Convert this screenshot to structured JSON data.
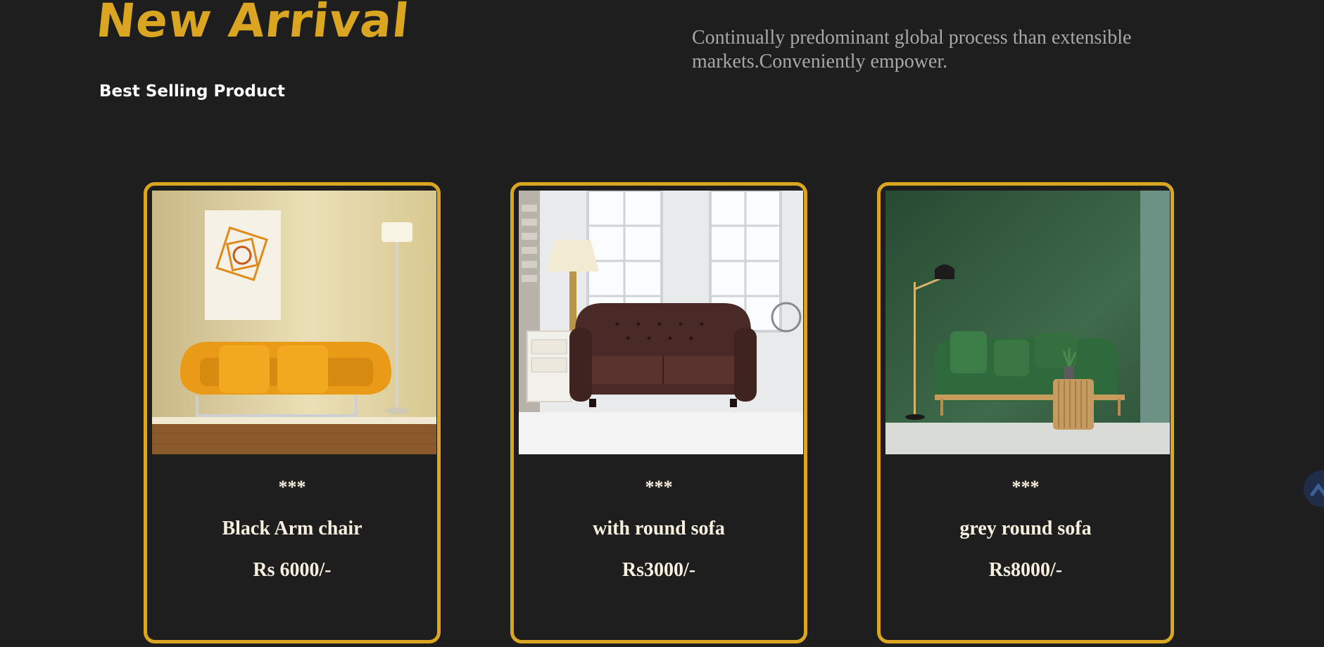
{
  "header": {
    "title": "New Arrival",
    "subtitle": "Best Selling Product",
    "tagline": "Continually predominant global process than extensible markets.Conveniently empower."
  },
  "products": [
    {
      "stars": "***",
      "name": "Black Arm chair",
      "price": "Rs 6000/-",
      "image": "orange-sofa-image"
    },
    {
      "stars": "***",
      "name": "with round sofa",
      "price": "Rs3000/-",
      "image": "leather-chesterfield-sofa-image"
    },
    {
      "stars": "***",
      "name": "grey round sofa",
      "price": "Rs8000/-",
      "image": "green-velvet-sofa-image"
    }
  ],
  "colors": {
    "background": "#1e1e1e",
    "accent": "#daa520",
    "card_text": "#f7efdf",
    "tagline": "#a8a8a8"
  }
}
